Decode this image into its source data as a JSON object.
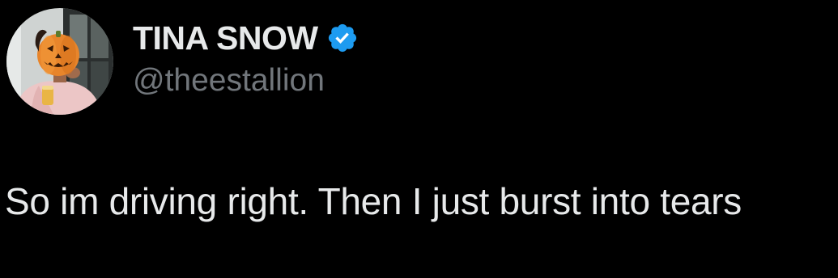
{
  "user": {
    "display_name": "TINA SNOW",
    "handle": "@theestallion",
    "verified": true,
    "avatar_icon": "profile-photo-pumpkin-mask"
  },
  "tweet": {
    "text": "So im driving right. Then I just burst into tears"
  },
  "colors": {
    "background": "#000000",
    "primary_text": "#e7e9ea",
    "secondary_text": "#71767b",
    "verified_blue": "#1d9bf0"
  }
}
